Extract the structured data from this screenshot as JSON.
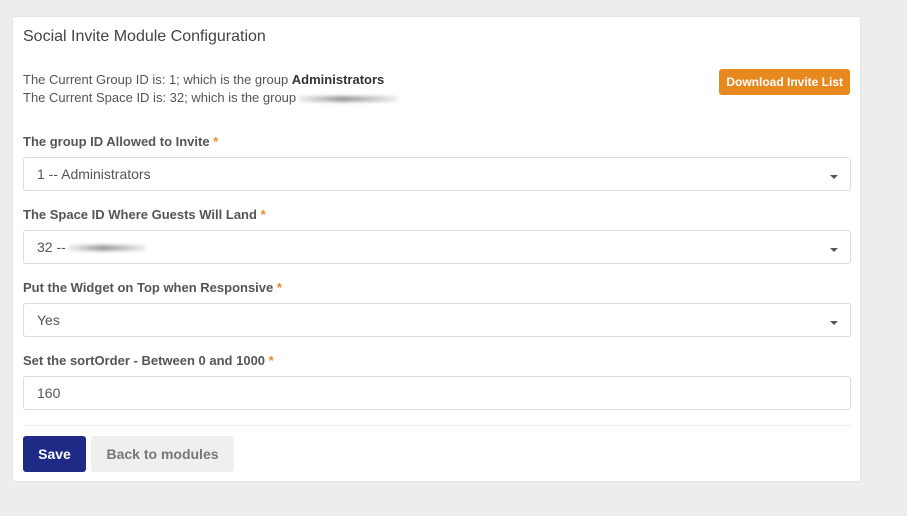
{
  "panel": {
    "title": "Social Invite Module Configuration",
    "info": {
      "group_prefix": "The Current Group ID is: 1; which is the group ",
      "group_name": "Administrators",
      "space_prefix": "The Current Space ID is: 32; which is the group"
    },
    "download_label": "Download Invite List"
  },
  "form": {
    "required_mark": "*",
    "group_field": {
      "label": "The group ID Allowed to Invite",
      "value": "1 -- Administrators"
    },
    "space_field": {
      "label": "The Space ID Where Guests Will Land",
      "value": "32 --"
    },
    "widget_field": {
      "label": "Put the Widget on Top when Responsive",
      "value": "Yes"
    },
    "sort_field": {
      "label": "Set the sortOrder - Between 0 and 1000",
      "value": "160"
    }
  },
  "actions": {
    "save_label": "Save",
    "back_label": "Back to modules"
  },
  "colors": {
    "accent_orange": "#e8891f",
    "primary_blue": "#1f2a86",
    "background": "#ededed"
  }
}
